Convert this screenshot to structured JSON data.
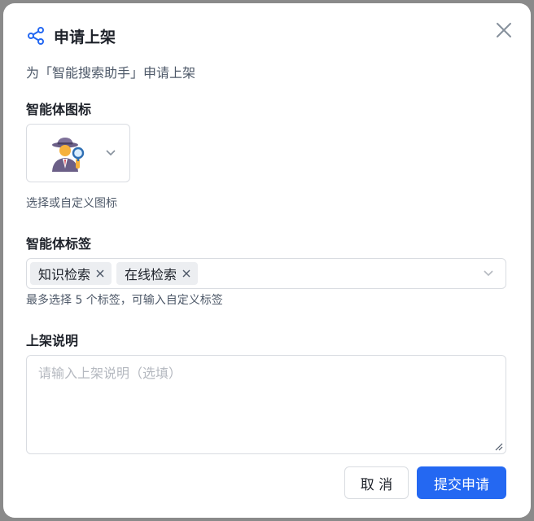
{
  "dialog": {
    "title": "申请上架",
    "subtitle": "为「智能搜索助手」申请上架",
    "icons": {
      "header": "share-icon",
      "close": "close-icon"
    },
    "accent_color": "#2468f2"
  },
  "agent_icon": {
    "label": "智能体图标",
    "selected": "detective-emoji",
    "hint": "选择或自定义图标"
  },
  "agent_tags": {
    "label": "智能体标签",
    "tags": [
      "知识检索",
      "在线检索"
    ],
    "hint": "最多选择 5 个标签，可输入自定义标签"
  },
  "description": {
    "label": "上架说明",
    "placeholder": "请输入上架说明（选填）",
    "value": ""
  },
  "actions": {
    "cancel": "取 消",
    "submit": "提交申请"
  }
}
